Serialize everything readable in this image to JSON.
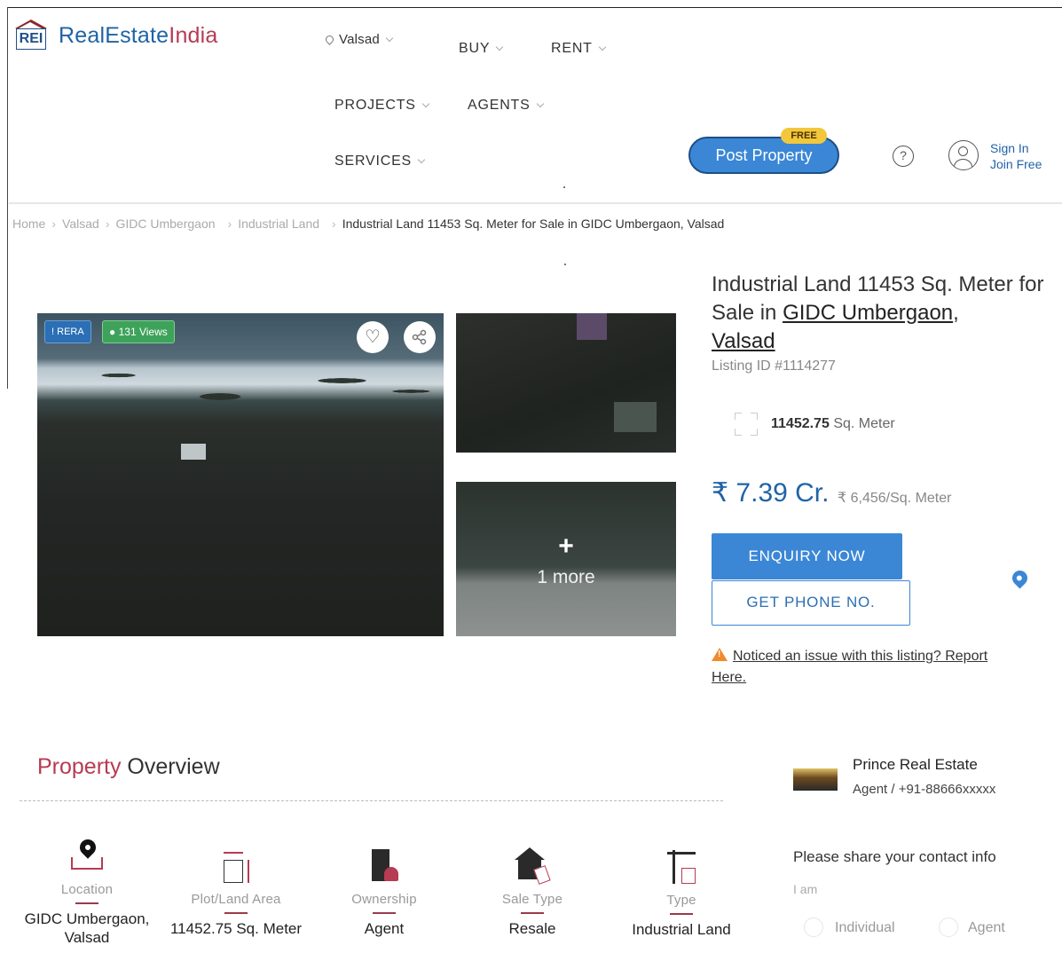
{
  "brand": {
    "logo_mark": "REI",
    "name_part1": "RealEstate",
    "name_part2": "India",
    "colors": {
      "primary": "#1f63a6",
      "accent": "#b73b52",
      "button": "#3b87d6"
    }
  },
  "nav": {
    "location": "Valsad",
    "items": [
      "BUY",
      "RENT",
      "PROJECTS",
      "AGENTS",
      "SERVICES"
    ],
    "post_property": "Post Property",
    "free_badge": "FREE",
    "help": "?",
    "sign_in": "Sign In",
    "join_free": "Join Free"
  },
  "breadcrumb": [
    "Home",
    "Valsad",
    "GIDC Umbergaon",
    "Industrial Land",
    "Industrial Land 11453 Sq. Meter for Sale in GIDC Umbergaon, Valsad"
  ],
  "gallery": {
    "rera_badge": "RERA",
    "views": "131 Views",
    "more_count": "1 more",
    "plus": "+"
  },
  "listing": {
    "title_prefix": "Industrial Land 11453 Sq. Meter for Sale in ",
    "title_locality": "GIDC Umbergaon",
    "title_comma": ",",
    "title_city": "Valsad",
    "listing_id": "Listing ID #1114277",
    "area_value": "11452.75",
    "area_unit": "Sq. Meter",
    "price": "₹ 7.39 Cr.",
    "price_per_unit": "₹ 6,456/Sq. Meter",
    "enquiry_button": "ENQUIRY NOW",
    "phone_button": "GET PHONE NO.",
    "report_text": "Noticed an issue with this listing? Report Here."
  },
  "overview": {
    "title_accent": "Property",
    "title_rest": " Overview",
    "items": [
      {
        "label": "Location",
        "value": "GIDC Umbergaon, Valsad",
        "icon": "location-pin-icon"
      },
      {
        "label": "Plot/Land Area",
        "value": "11452.75 Sq. Meter",
        "icon": "plot-area-icon"
      },
      {
        "label": "Ownership",
        "value": "Agent",
        "icon": "ownership-building-icon"
      },
      {
        "label": "Sale Type",
        "value": "Resale",
        "icon": "sale-house-icon"
      },
      {
        "label": "Type",
        "value": "Industrial Land",
        "icon": "industrial-crane-icon"
      }
    ]
  },
  "agent": {
    "name": "Prince Real Estate",
    "meta": "Agent / +91-88666xxxxx",
    "contact_heading": "Please share your contact info",
    "i_am": "I am",
    "options": [
      "Individual",
      "Agent"
    ]
  }
}
